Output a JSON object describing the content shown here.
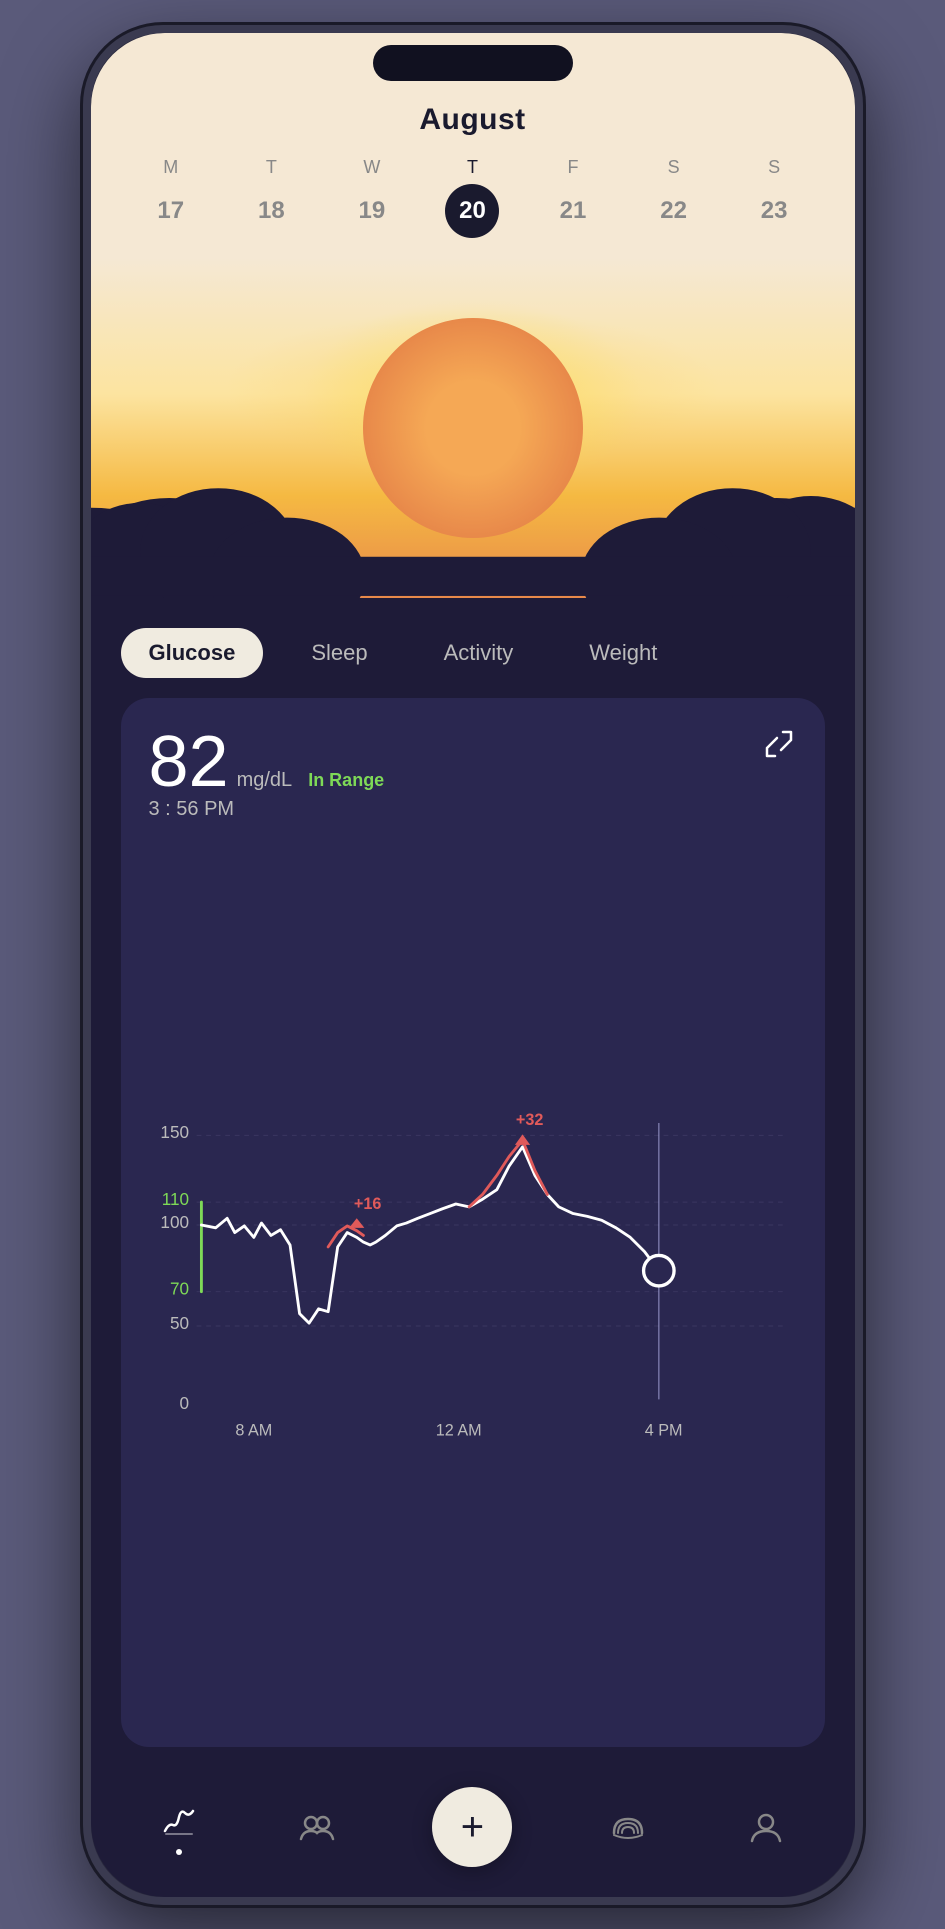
{
  "month": "August",
  "calendar": {
    "days": [
      {
        "letter": "M",
        "num": "17",
        "active": false
      },
      {
        "letter": "T",
        "num": "18",
        "active": false
      },
      {
        "letter": "W",
        "num": "19",
        "active": false
      },
      {
        "letter": "T",
        "num": "20",
        "active": true
      },
      {
        "letter": "F",
        "num": "21",
        "active": false
      },
      {
        "letter": "S",
        "num": "22",
        "active": false
      },
      {
        "letter": "S",
        "num": "23",
        "active": false
      }
    ]
  },
  "tabs": [
    {
      "label": "Glucose",
      "active": true
    },
    {
      "label": "Sleep",
      "active": false
    },
    {
      "label": "Activity",
      "active": false
    },
    {
      "label": "Weight",
      "active": false
    }
  ],
  "glucose": {
    "value": "82",
    "unit": "mg/dL",
    "status": "In Range",
    "time": "3 : 56 PM"
  },
  "chart": {
    "y_labels": [
      "150",
      "110",
      "100",
      "70",
      "50",
      "0"
    ],
    "x_labels": [
      "8 AM",
      "12 AM",
      "4 PM"
    ],
    "spike1_label": "+16",
    "spike2_label": "+32"
  },
  "nav": {
    "items": [
      {
        "name": "chart-icon",
        "active": true
      },
      {
        "name": "community-icon",
        "active": false
      },
      {
        "name": "add-icon",
        "active": false
      },
      {
        "name": "rainbow-icon",
        "active": false
      },
      {
        "name": "profile-icon",
        "active": false
      }
    ]
  }
}
